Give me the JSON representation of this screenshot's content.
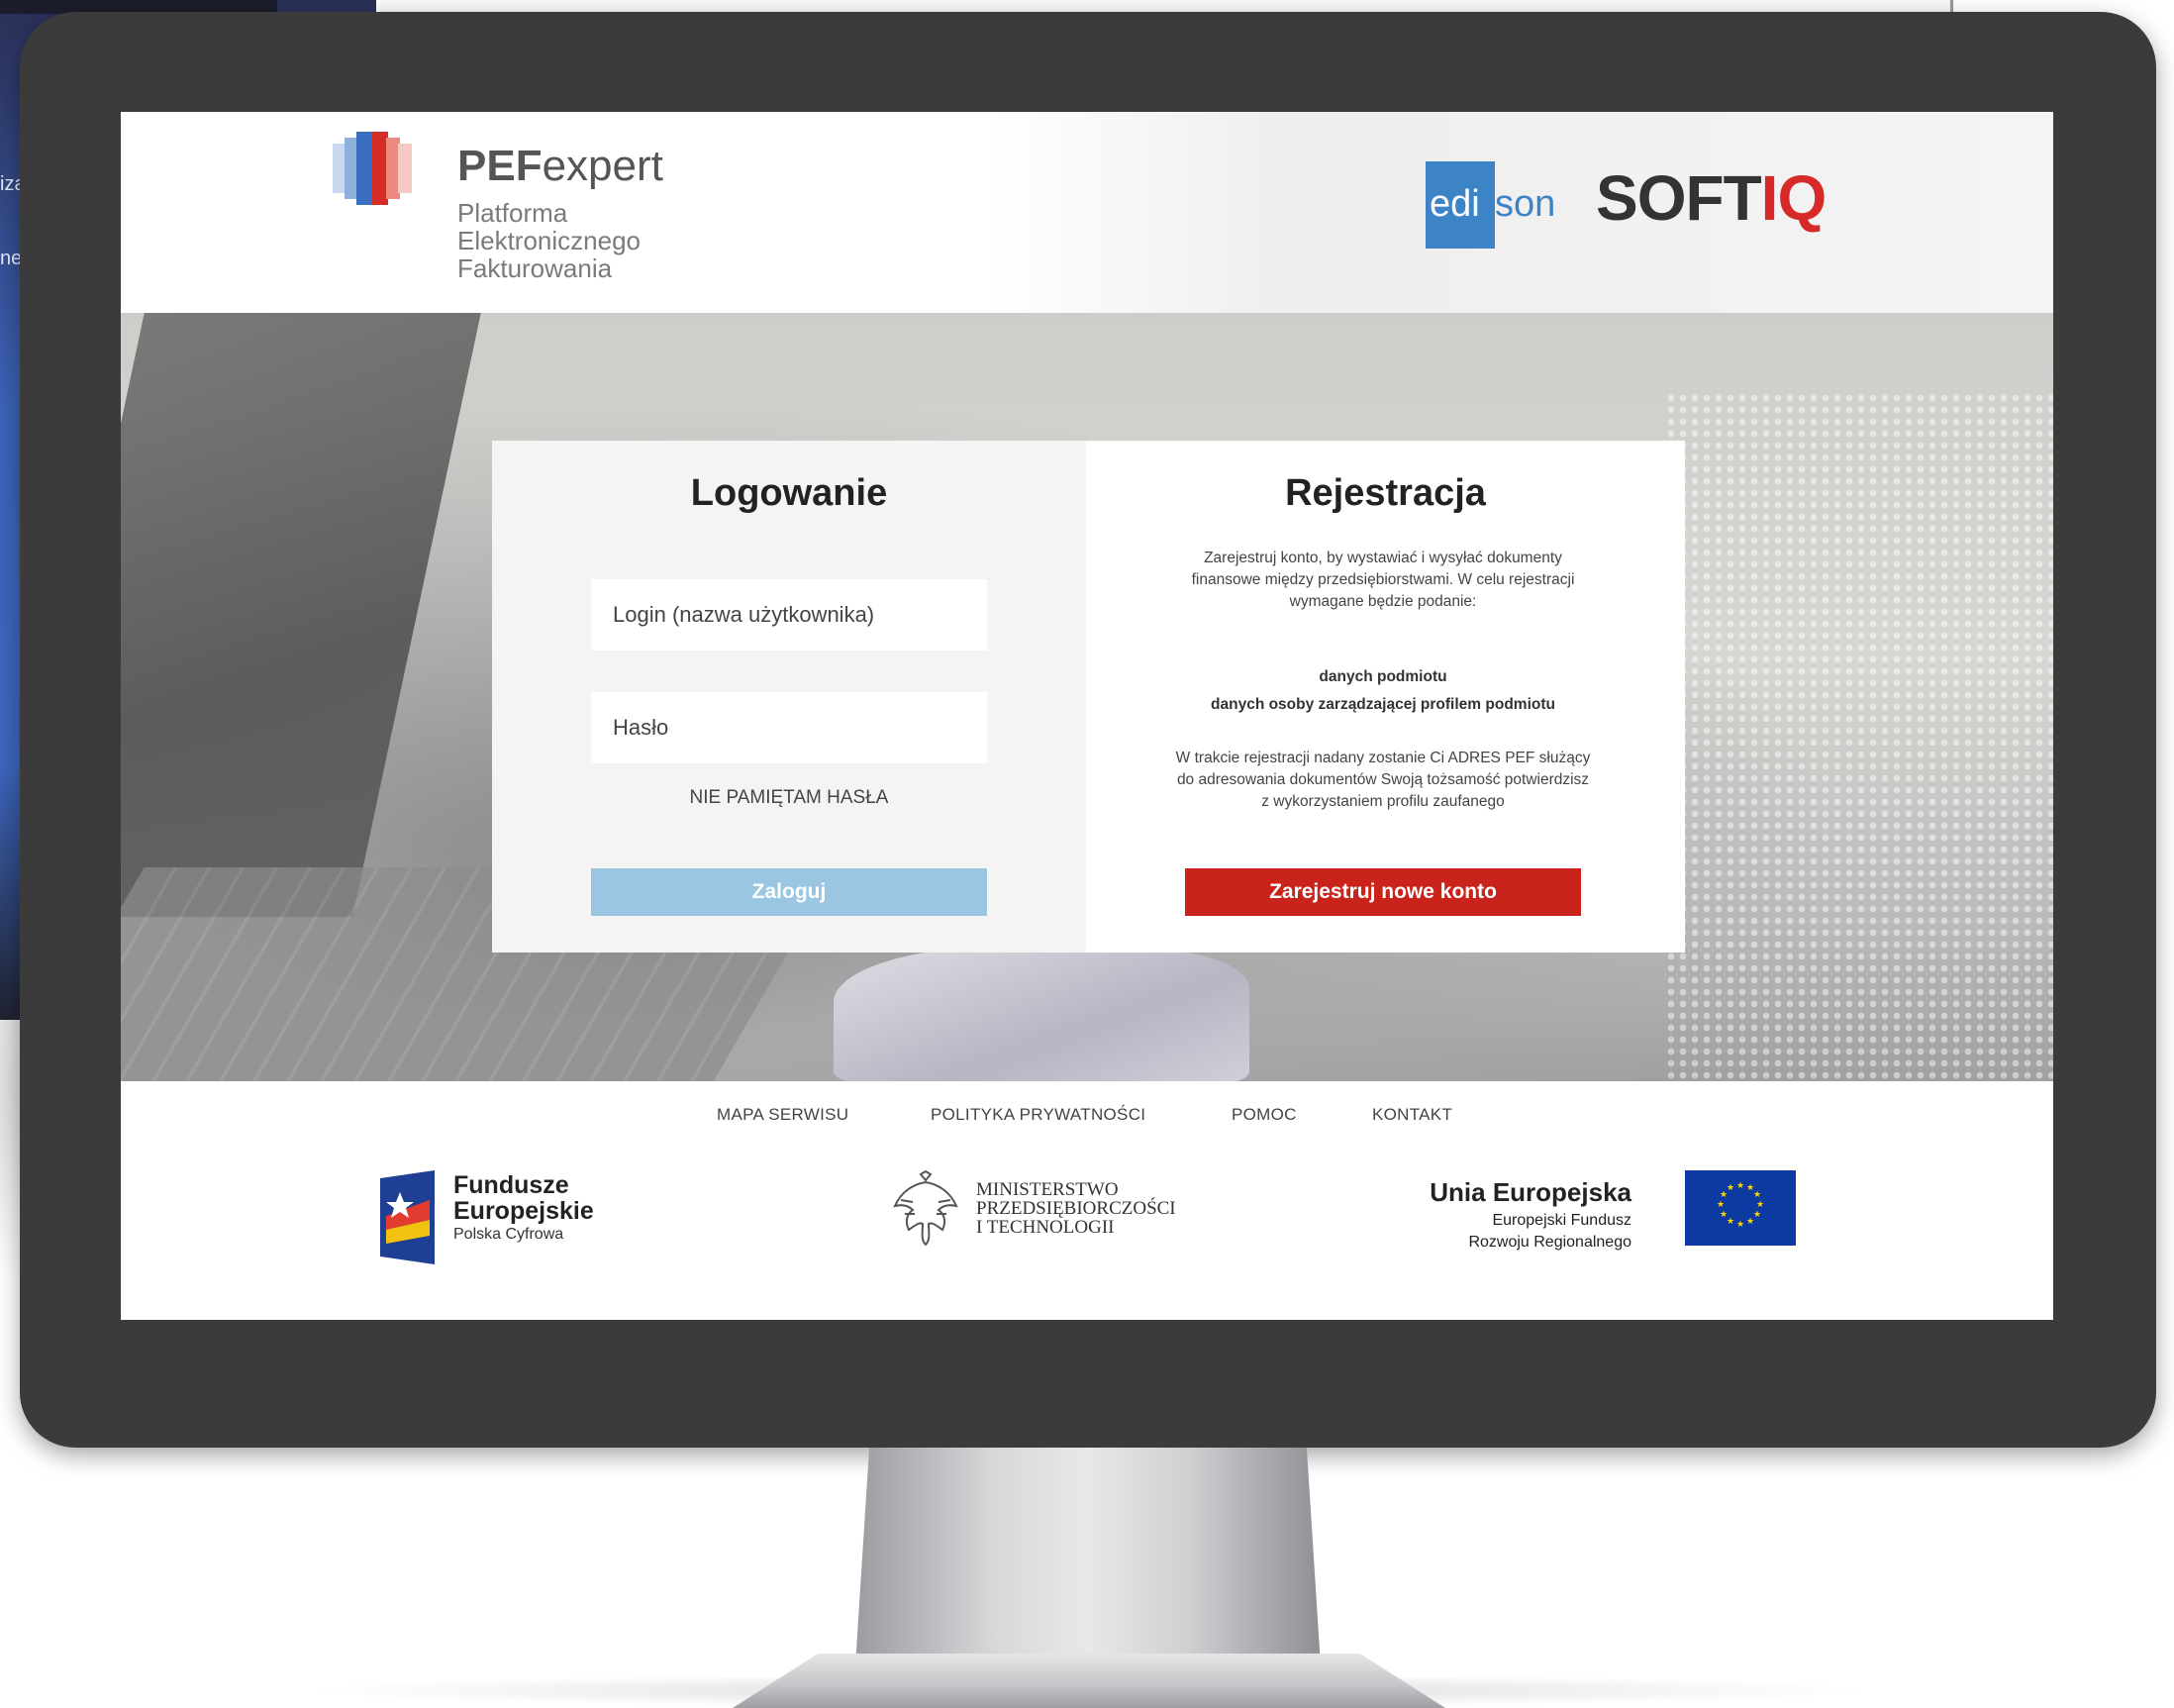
{
  "background": {
    "side_text_1": "iza",
    "side_text_2": "ne"
  },
  "header": {
    "brand_bold": "PEF",
    "brand_rest": "expert",
    "brand_line1": "Platforma",
    "brand_line2": "Elektronicznego",
    "brand_line3": "Fakturowania",
    "partner1_a": "edi",
    "partner1_b": "son",
    "partner2_a": "SOFT",
    "partner2_b": "IQ"
  },
  "login": {
    "title": "Logowanie",
    "login_placeholder": "Login (nazwa użytkownika)",
    "password_placeholder": "Hasło",
    "forgot": "NIE PAMIĘTAM HASŁA",
    "submit": "Zaloguj"
  },
  "register": {
    "title": "Rejestracja",
    "intro": "Zarejestruj konto, by wystawiać i wysyłać dokumenty finansowe między przedsiębiorstwami. W celu rejestracji wymagane będzie podanie:",
    "req1": "danych podmiotu",
    "req2": "danych osoby zarządzającej profilem podmiotu",
    "info": "W trakcie rejestracji nadany zostanie Ci ADRES PEF służący do adresowania dokumentów Swoją tożsamość potwierdzisz z wykorzystaniem profilu zaufanego",
    "submit": "Zarejestruj nowe konto"
  },
  "footer": {
    "links": [
      "MAPA SERWISU",
      "POLITYKA PRYWATNOŚCI",
      "POMOC",
      "KONTAKT"
    ],
    "fe_line1": "Fundusze",
    "fe_line2": "Europejskie",
    "fe_line3": "Polska Cyfrowa",
    "ministry_line1": "MINISTERSTWO",
    "ministry_line2": "PRZEDSIĘBIORCZOŚCI",
    "ministry_line3": "I TECHNOLOGII",
    "ue_title": "Unia Europejska",
    "ue_sub1": "Europejski Fundusz",
    "ue_sub2": "Rozwoju Regionalnego"
  },
  "colors": {
    "login_button": "#9ac6e2",
    "register_button": "#c9231b",
    "softiq_accent": "#d72a28",
    "edison_blue": "#3d84c6",
    "eu_blue": "#0c3aa1",
    "eu_star": "#ffd700"
  },
  "icons": [
    "pef-logo-icon",
    "fundusze-europejskie-flag-icon",
    "polish-eagle-icon",
    "eu-flag-icon"
  ]
}
